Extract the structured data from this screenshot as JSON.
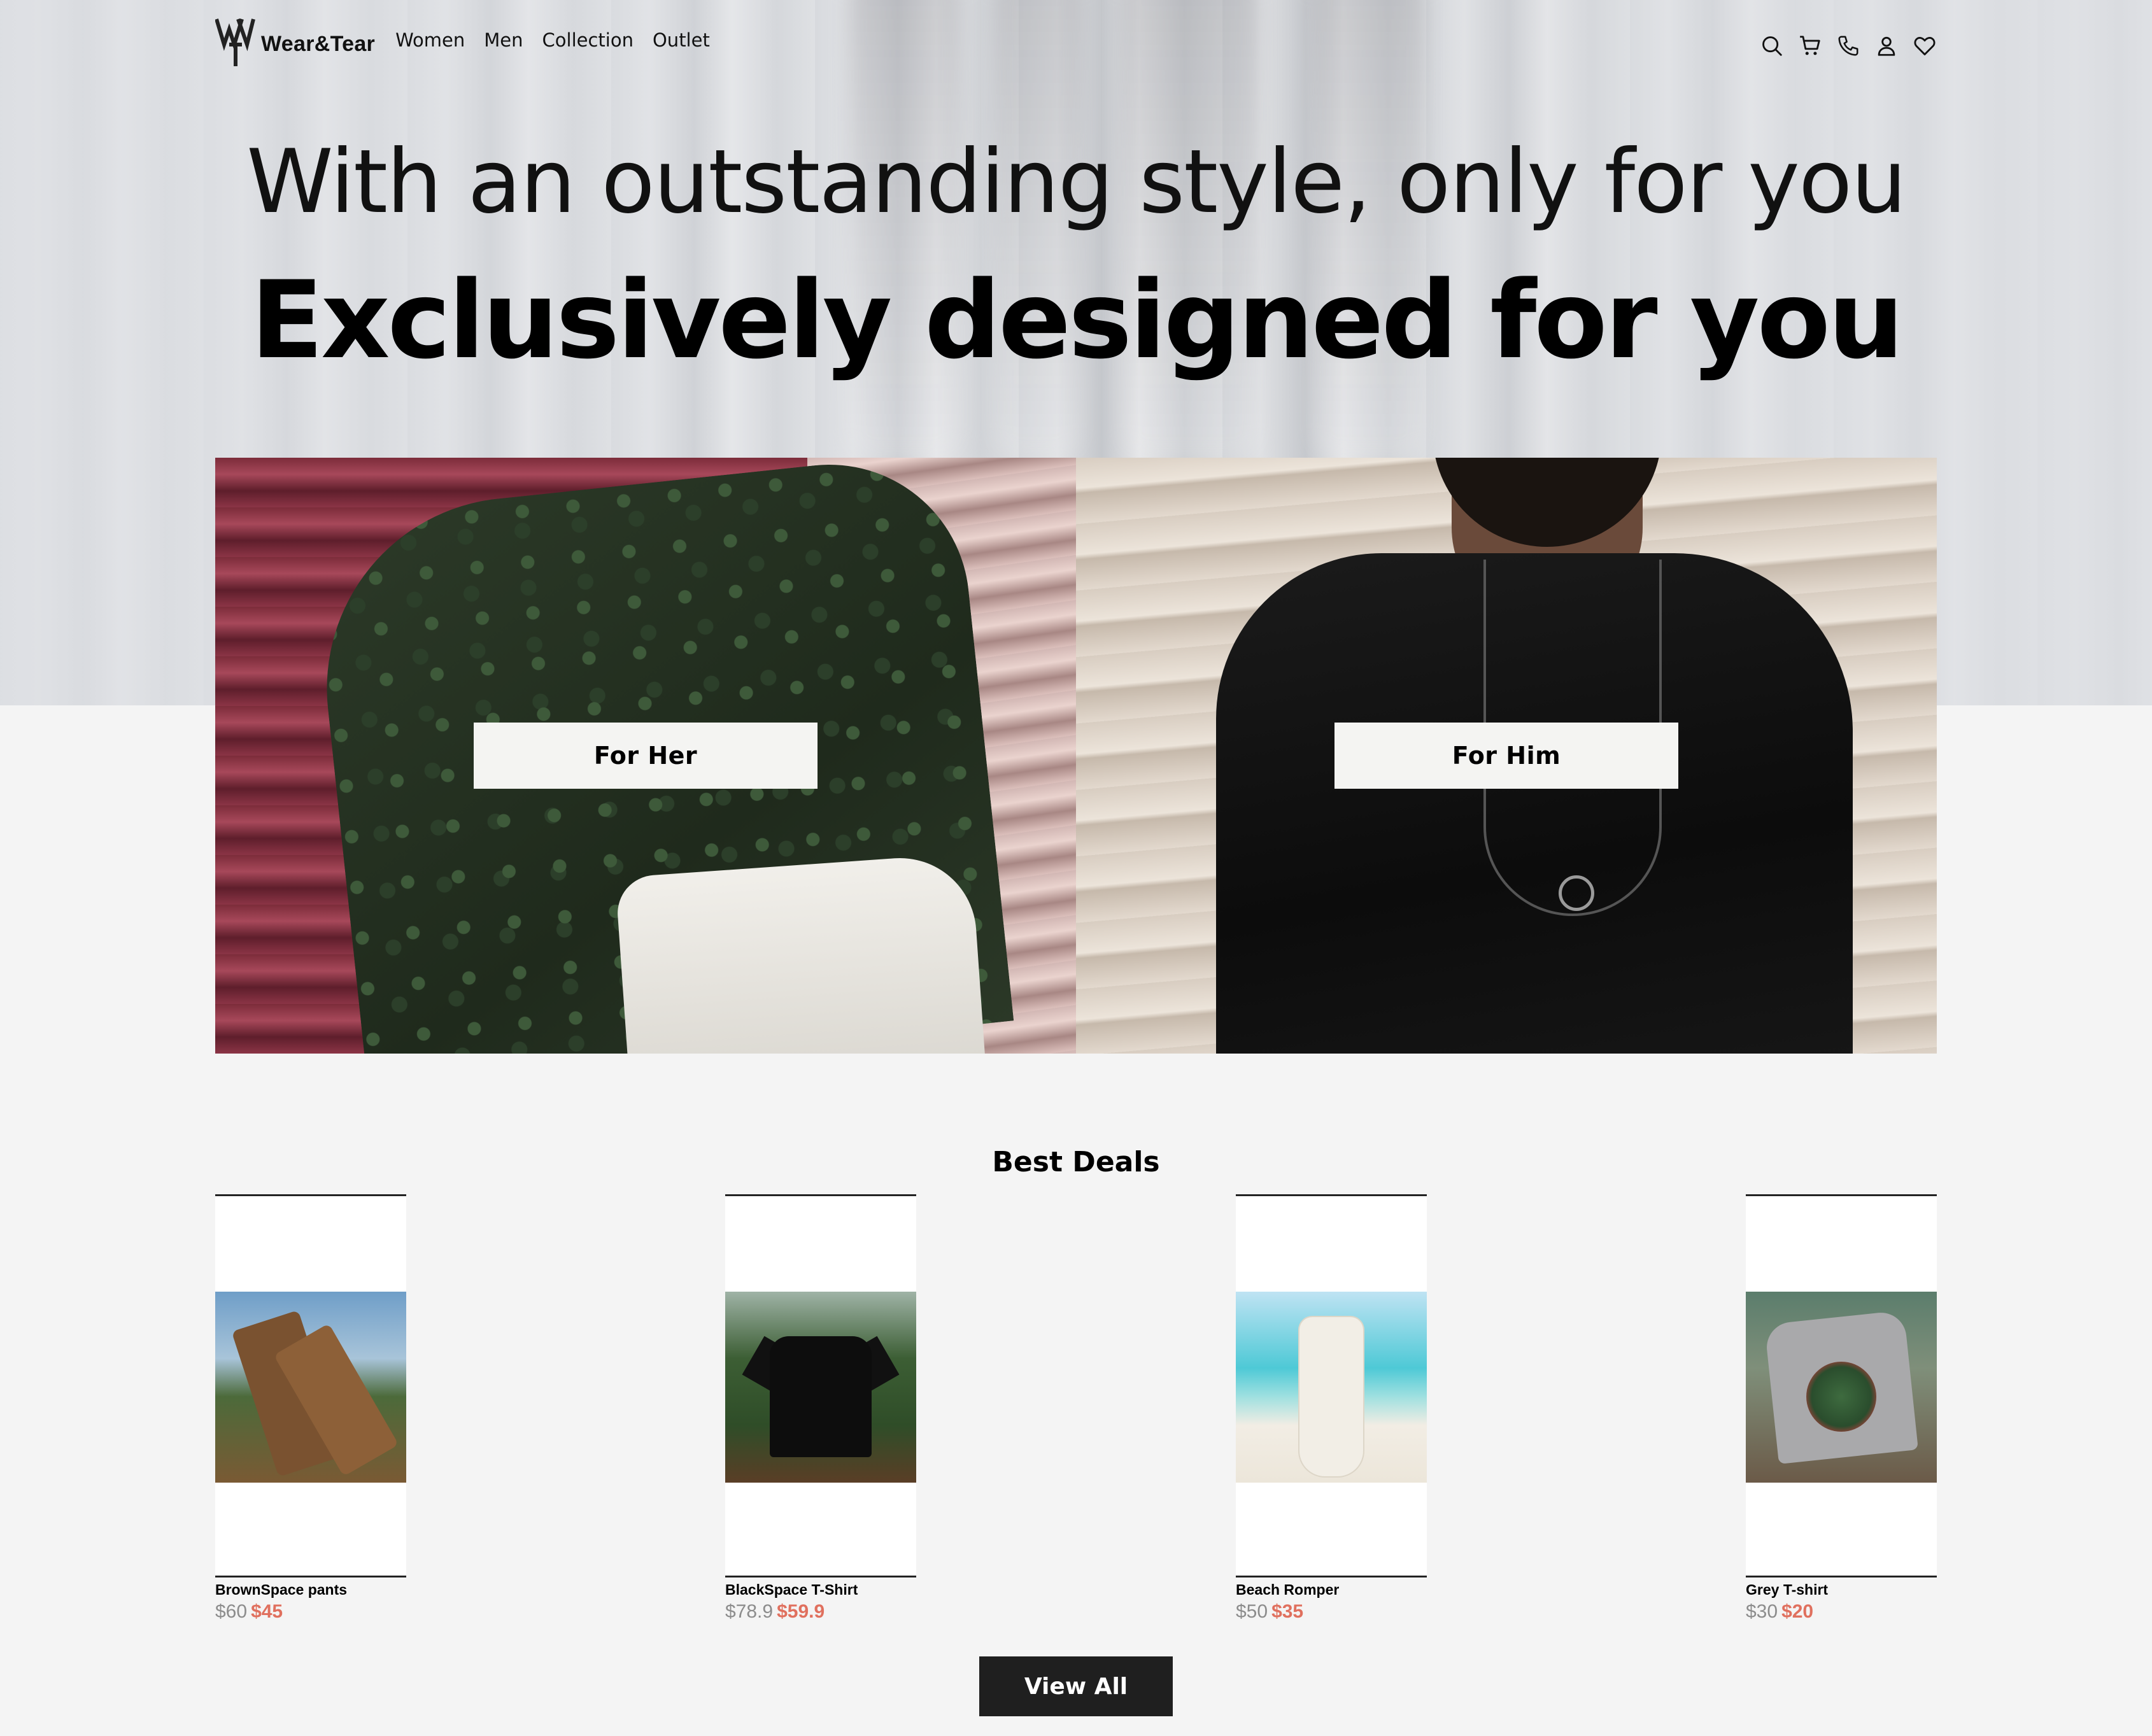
{
  "brand": {
    "name": "Wear&Tear"
  },
  "nav": {
    "links": [
      "Women",
      "Men",
      "Collection",
      "Outlet"
    ],
    "icons": [
      "search-icon",
      "cart-icon",
      "phone-icon",
      "user-icon",
      "heart-icon"
    ]
  },
  "hero": {
    "headline": "With an outstanding style, only for you",
    "subheadline": "Exclusively designed for you"
  },
  "categories": [
    {
      "label": "For Her"
    },
    {
      "label": "For Him"
    }
  ],
  "best_deals": {
    "title": "Best Deals",
    "products": [
      {
        "name": "BrownSpace pants",
        "old_price": "$60",
        "new_price": "$45"
      },
      {
        "name": "BlackSpace T-Shirt",
        "old_price": "$78.9",
        "new_price": "$59.9"
      },
      {
        "name": "Beach Romper",
        "old_price": "$50",
        "new_price": "$35"
      },
      {
        "name": "Grey T-shirt",
        "old_price": "$30",
        "new_price": "$20"
      }
    ],
    "view_all_label": "View All"
  },
  "colors": {
    "accent_price": "#e0705e",
    "old_price": "#8c8c8c",
    "button_dark": "#1f1f1f",
    "page_bg": "#f4f4f4"
  }
}
